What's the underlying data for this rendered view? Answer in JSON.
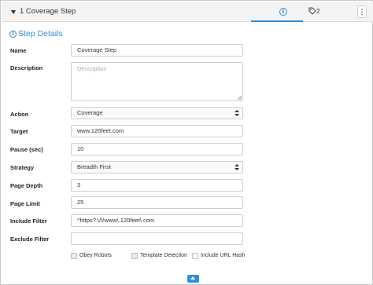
{
  "header": {
    "title": "1 Coverage Step",
    "tags_count": "2",
    "more_label": "⋮"
  },
  "section": {
    "title": "Step Details"
  },
  "form": {
    "name": {
      "label": "Name",
      "value": "Coverage Step"
    },
    "description": {
      "label": "Description",
      "placeholder": "Description"
    },
    "action": {
      "label": "Action",
      "value": "Coverage"
    },
    "target": {
      "label": "Target",
      "value": "www.120feet.com"
    },
    "pause": {
      "label": "Pause (sec)",
      "value": "10"
    },
    "strategy": {
      "label": "Strategy",
      "value": "Breadth First"
    },
    "page_depth": {
      "label": "Page Depth",
      "value": "3"
    },
    "page_limit": {
      "label": "Page Limit",
      "value": "25"
    },
    "include_filter": {
      "label": "Include Filter",
      "value": "^https?:\\/\\/www\\.120feet\\.com"
    },
    "exclude_filter": {
      "label": "Exclude Filter",
      "value": ""
    }
  },
  "options": [
    {
      "label": "Obey Robots",
      "checked": true
    },
    {
      "label": "Template Detection",
      "checked": true
    },
    {
      "label": "Include URL Hash",
      "checked": false
    }
  ],
  "colors": {
    "accent": "#2f8fd8",
    "header_bg": "#f3f3f3",
    "border": "#cfcfcf"
  }
}
